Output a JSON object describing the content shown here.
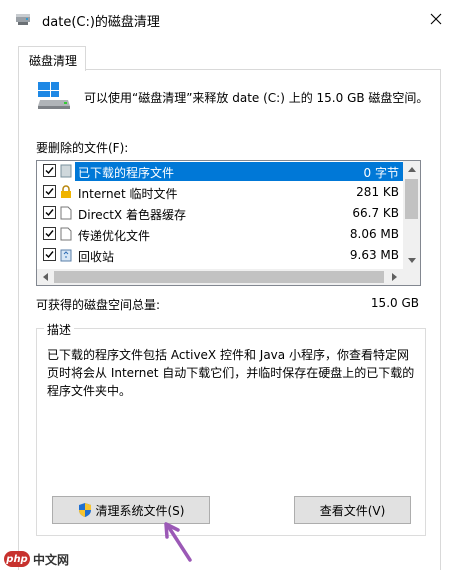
{
  "window": {
    "title": "date(C:)的磁盘清理"
  },
  "tabs": [
    {
      "label": "磁盘清理"
    }
  ],
  "intro": {
    "text": "可以使用“磁盘清理”来释放 date (C:) 上的 15.0 GB 磁盘空间。"
  },
  "files": {
    "label": "要删除的文件(F):",
    "items": [
      {
        "name": "已下载的程序文件",
        "size": "0 字节",
        "checked": true,
        "selected": true,
        "icon": "folder-icon"
      },
      {
        "name": "Internet 临时文件",
        "size": "281 KB",
        "checked": true,
        "selected": false,
        "icon": "lock-icon"
      },
      {
        "name": "DirectX 着色器缓存",
        "size": "66.7 KB",
        "checked": true,
        "selected": false,
        "icon": "file-icon"
      },
      {
        "name": "传递优化文件",
        "size": "8.06 MB",
        "checked": true,
        "selected": false,
        "icon": "file-icon"
      },
      {
        "name": "回收站",
        "size": "9.63 MB",
        "checked": true,
        "selected": false,
        "icon": "recycle-bin-icon"
      }
    ]
  },
  "available": {
    "label": "可获得的磁盘空间总量:",
    "value": "15.0 GB"
  },
  "description": {
    "title": "描述",
    "text": "已下载的程序文件包括 ActiveX 控件和 Java 小程序，你查看特定网页时将会从 Internet 自动下载它们，并临时保存在硬盘上的已下载的程序文件夹中。"
  },
  "buttons": {
    "clean_system": "清理系统文件(S)",
    "view_files": "查看文件(V)"
  },
  "watermark": {
    "logo": "php",
    "text": "中文网"
  },
  "colors": {
    "selection": "#0078d7",
    "arrow": "#9b59b6",
    "watermark": "#c7322e"
  }
}
